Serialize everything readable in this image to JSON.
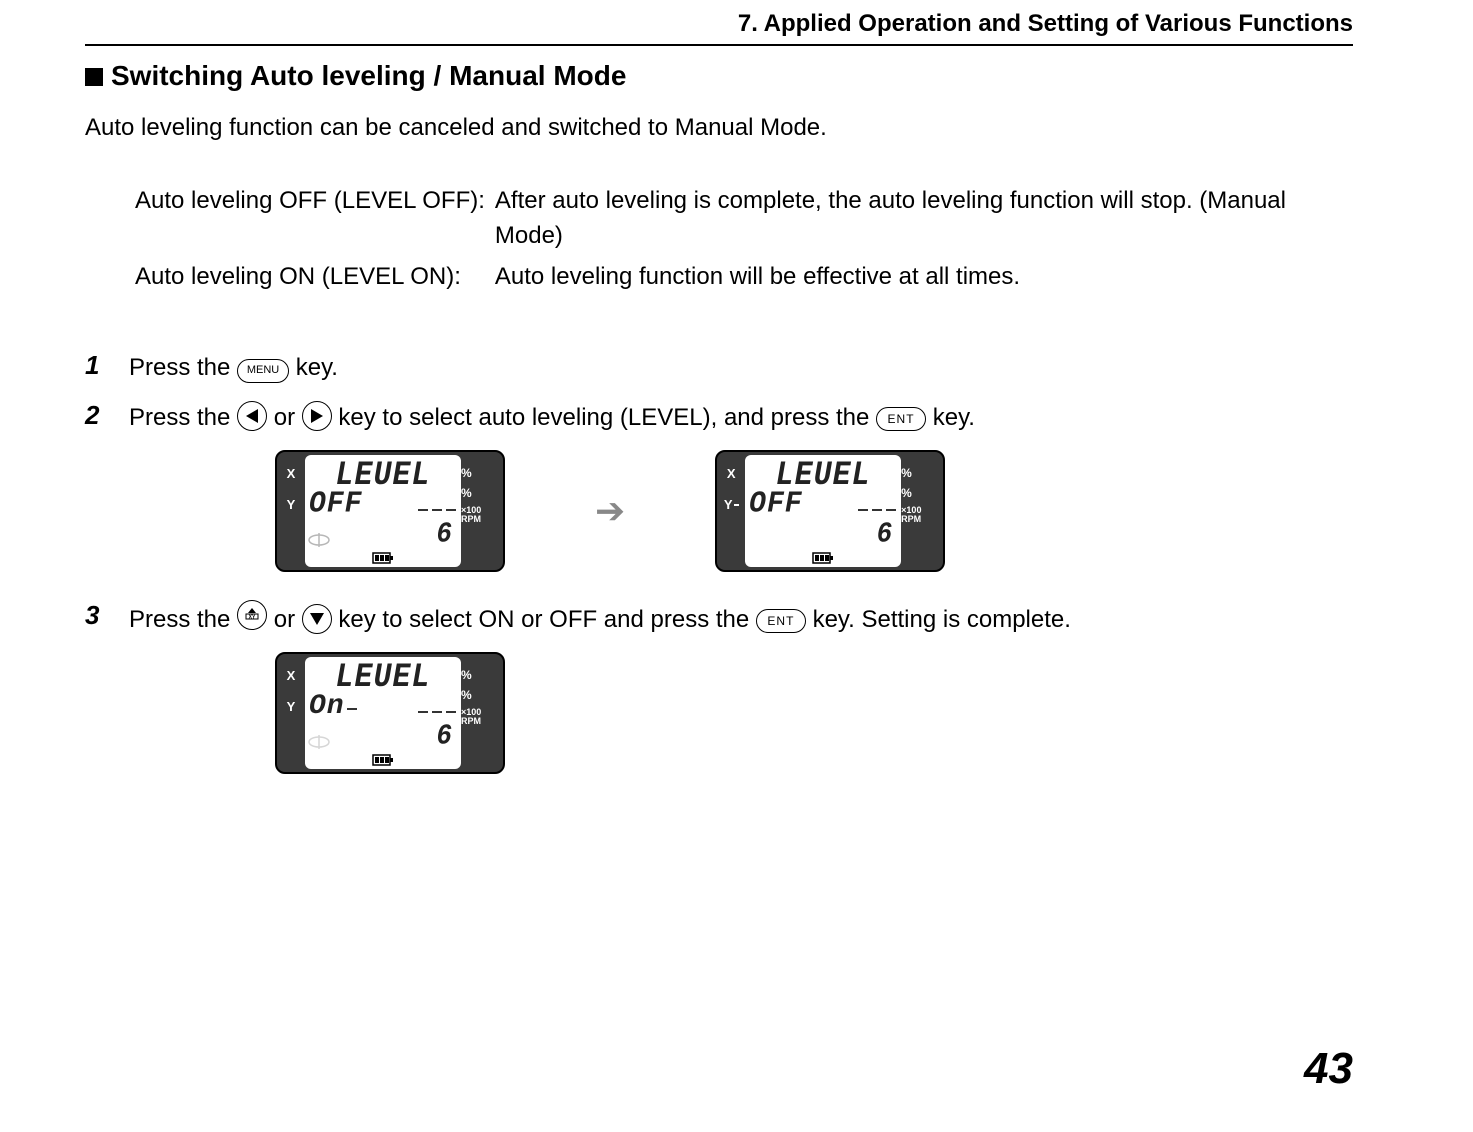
{
  "header": "7.  Applied Operation and Setting of Various Functions",
  "section_title": "Switching Auto leveling / Manual Mode",
  "intro": "Auto leveling function can be canceled and switched to Manual Mode.",
  "defs": [
    {
      "label": "Auto leveling OFF (LEVEL OFF):",
      "text": "After auto leveling is complete, the auto leveling function will stop. (Manual Mode)"
    },
    {
      "label": "Auto leveling ON (LEVEL ON):",
      "text": "Auto leveling function will be effective at all times."
    }
  ],
  "steps": {
    "s1": {
      "num": "1",
      "pre": "Press the ",
      "post": " key."
    },
    "s2": {
      "num": "2",
      "pre": "Press the ",
      "mid1": " or ",
      "mid2": " key to select auto leveling (LEVEL), and press the ",
      "post": " key."
    },
    "s3": {
      "num": "3",
      "pre": "Press the ",
      "mid1": " or ",
      "mid2": " key to select ON or OFF and press the ",
      "post": " key. Setting is complete."
    }
  },
  "keys": {
    "menu": "MENU",
    "ent": "ENT"
  },
  "lcd": {
    "x": "X",
    "y": "Y",
    "pct": "%",
    "x100": "×100",
    "rpm": "RPM",
    "line1": "LEUEL",
    "off": "OFF",
    "on": "On",
    "six": "6"
  },
  "page_number": "43"
}
